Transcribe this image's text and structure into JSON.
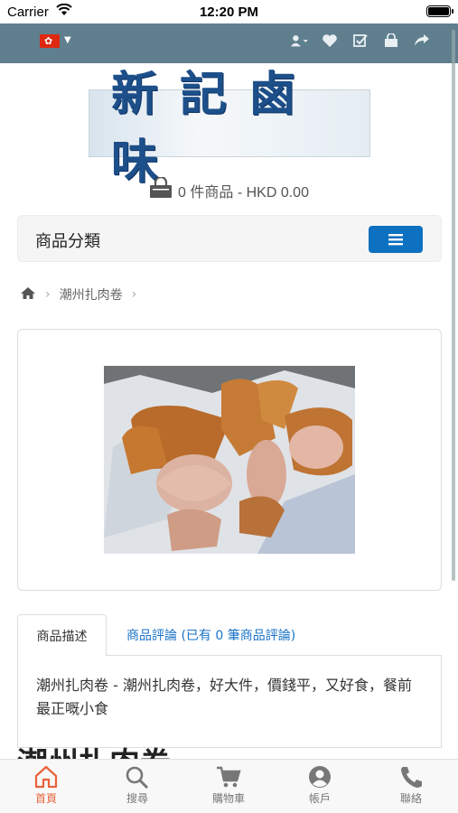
{
  "status_bar": {
    "carrier": "Carrier",
    "time": "12:20 PM"
  },
  "top_bar": {
    "language_flag": "hk-flag",
    "icons": [
      "user-icon",
      "heart-icon",
      "checklist-icon",
      "shopping-bag-icon",
      "share-icon"
    ]
  },
  "logo": {
    "text": "新記鹵味"
  },
  "cart_summary": {
    "text": "0 件商品 - HKD 0.00"
  },
  "category": {
    "label": "商品分類"
  },
  "breadcrumb": {
    "items": [
      "潮州扎肉卷"
    ]
  },
  "product": {
    "tab_description": "商品描述",
    "tab_reviews": "商品評論 (已有 0 筆商品評論)",
    "description": "潮州扎肉卷 - 潮州扎肉卷，好大件，價錢平，又好食，餐前最正嘅小食",
    "title": "潮州扎肉卷"
  },
  "tab_bar": {
    "items": [
      {
        "label": "首頁",
        "icon": "home-icon"
      },
      {
        "label": "搜尋",
        "icon": "search-icon"
      },
      {
        "label": "購物車",
        "icon": "cart-icon"
      },
      {
        "label": "帳戶",
        "icon": "account-icon"
      },
      {
        "label": "聯絡",
        "icon": "phone-icon"
      }
    ]
  },
  "colors": {
    "topbar": "#5f7f8f",
    "accent": "#e8623a",
    "button": "#0d70c0",
    "link": "#1a73c8"
  }
}
